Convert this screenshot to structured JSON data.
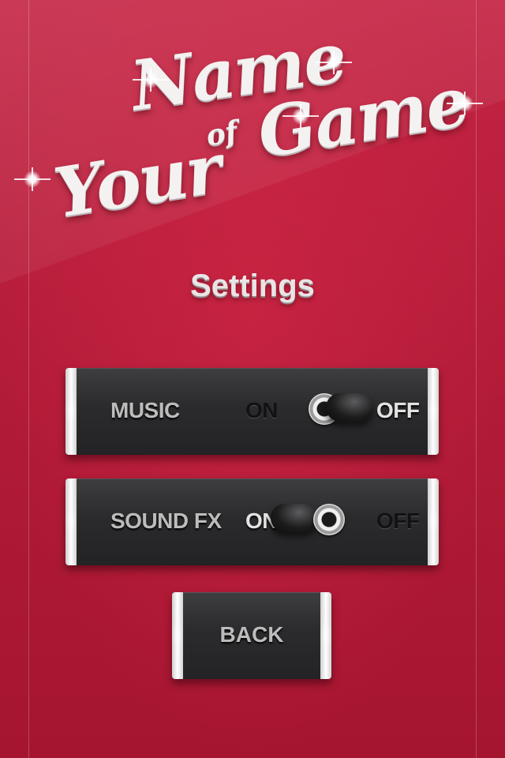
{
  "logo": {
    "line1": "Name",
    "of": "of",
    "game": "Game",
    "your": "Your"
  },
  "screen_title": "Settings",
  "settings": [
    {
      "label": "MUSIC",
      "on_label": "ON",
      "off_label": "OFF",
      "state": "OFF"
    },
    {
      "label": "SOUND FX",
      "on_label": "ON",
      "off_label": "OFF",
      "state": "ON"
    }
  ],
  "back_button": {
    "label": "BACK"
  },
  "colors": {
    "background": "#b31a35",
    "panel": "#2b2b2d",
    "label_light": "#bdbcbc",
    "label_dark": "#121213"
  }
}
